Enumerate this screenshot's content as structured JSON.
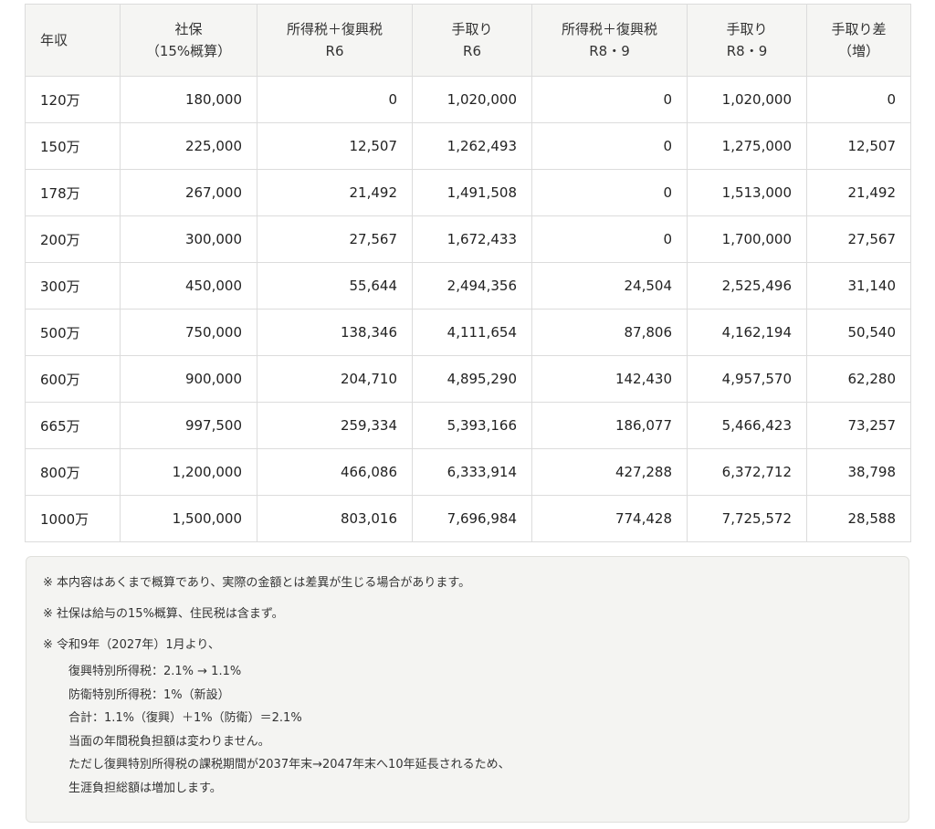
{
  "table": {
    "headers": [
      [
        "年収"
      ],
      [
        "社保",
        "（15%概算）"
      ],
      [
        "所得税＋復興税",
        "R6"
      ],
      [
        "手取り",
        "R6"
      ],
      [
        "所得税＋復興税",
        "R8・9"
      ],
      [
        "手取り",
        "R8・9"
      ],
      [
        "手取り差",
        "（増）"
      ]
    ],
    "rows": [
      [
        "120万",
        "180,000",
        "0",
        "1,020,000",
        "0",
        "1,020,000",
        "0"
      ],
      [
        "150万",
        "225,000",
        "12,507",
        "1,262,493",
        "0",
        "1,275,000",
        "12,507"
      ],
      [
        "178万",
        "267,000",
        "21,492",
        "1,491,508",
        "0",
        "1,513,000",
        "21,492"
      ],
      [
        "200万",
        "300,000",
        "27,567",
        "1,672,433",
        "0",
        "1,700,000",
        "27,567"
      ],
      [
        "300万",
        "450,000",
        "55,644",
        "2,494,356",
        "24,504",
        "2,525,496",
        "31,140"
      ],
      [
        "500万",
        "750,000",
        "138,346",
        "4,111,654",
        "87,806",
        "4,162,194",
        "50,540"
      ],
      [
        "600万",
        "900,000",
        "204,710",
        "4,895,290",
        "142,430",
        "4,957,570",
        "62,280"
      ],
      [
        "665万",
        "997,500",
        "259,334",
        "5,393,166",
        "186,077",
        "5,466,423",
        "73,257"
      ],
      [
        "800万",
        "1,200,000",
        "466,086",
        "6,333,914",
        "427,288",
        "6,372,712",
        "38,798"
      ],
      [
        "1000万",
        "1,500,000",
        "803,016",
        "7,696,984",
        "774,428",
        "7,725,572",
        "28,588"
      ]
    ]
  },
  "notes": {
    "note1": "※ 本内容はあくまで概算であり、実際の金額とは差異が生じる場合があります。",
    "note2": "※ 社保は給与の15%概算、住民税は含まず。",
    "note3_title": "※ 令和9年（2027年）1月より、",
    "note3_details": [
      "復興特別所得税：2.1% → 1.1%",
      "防衛特別所得税：1%（新設）",
      "合計：1.1%（復興）＋1%（防衛）＝2.1%",
      "当面の年間税負担額は変わりません。",
      "ただし復興特別所得税の課税期間が2037年末→2047年末へ10年延長されるため、",
      "生涯負担総額は増加します。"
    ]
  }
}
